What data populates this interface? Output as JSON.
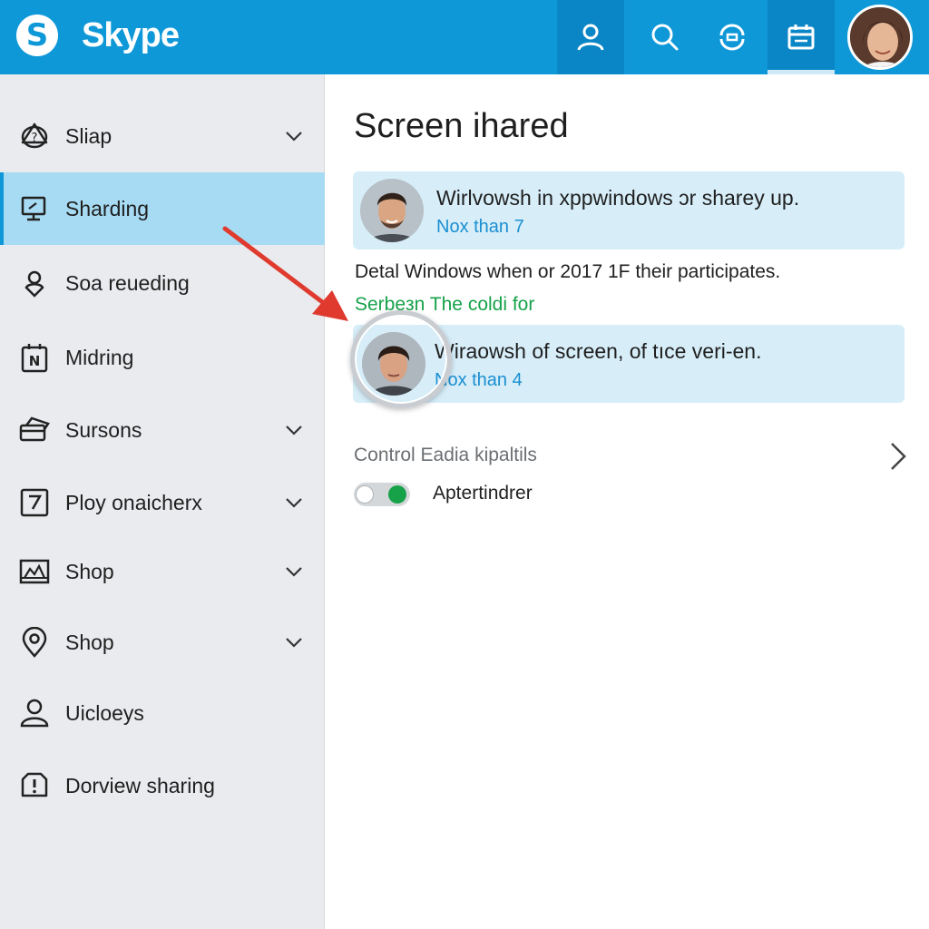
{
  "header": {
    "logo_letter": "S",
    "brand": "Skype",
    "accent": "#0f98d8",
    "buttons": [
      {
        "icon": "person-icon"
      },
      {
        "icon": "search-icon"
      },
      {
        "icon": "sync-icon"
      },
      {
        "icon": "calendar-icon"
      }
    ]
  },
  "sidebar": {
    "items": [
      {
        "label": "Sliap",
        "icon": "help-bubble-icon",
        "chevron": true
      },
      {
        "label": "Sharding",
        "icon": "screen-share-icon",
        "chevron": false,
        "active": true
      },
      {
        "label": "Soa reueding",
        "icon": "pin-icon",
        "chevron": false
      },
      {
        "label": "Midring",
        "icon": "n-box-icon",
        "chevron": false
      },
      {
        "label": "Sursons",
        "icon": "card-icon",
        "chevron": true
      },
      {
        "label": "Ploy onaicherx",
        "icon": "checkbox-icon",
        "chevron": true
      },
      {
        "label": "Shop",
        "icon": "chart-icon",
        "chevron": true
      },
      {
        "label": "Shop",
        "icon": "location-icon",
        "chevron": true
      },
      {
        "label": "Uicloeys",
        "icon": "user-icon",
        "chevron": false
      },
      {
        "label": "Dorview sharing",
        "icon": "alert-icon",
        "chevron": false
      }
    ]
  },
  "main": {
    "title": "Screen ihared",
    "cards": [
      {
        "title": "Wirlvowsh in xppwindows ɔr sharey up.",
        "subtitle": "Nox than 7"
      },
      {
        "title": "Wiraowsh of screen, of tıce veri-en.",
        "subtitle": "Nox than 4"
      }
    ],
    "description": "Detal Windows when or 2017 1F their participates.",
    "green_text": "Serbeзn The coldi for",
    "section_label": "Control Eadia kipaltils",
    "toggle_label": "Aptertindrer",
    "toggle_on_color": "#17a24a",
    "arrow_color": "#e03a2f"
  }
}
